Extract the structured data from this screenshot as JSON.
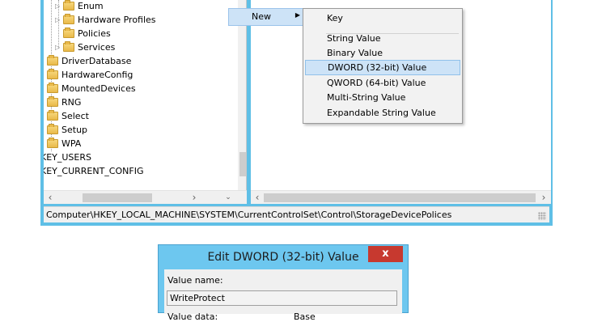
{
  "tree": {
    "items": [
      {
        "label": "Enum"
      },
      {
        "label": "Hardware Profiles"
      },
      {
        "label": "Policies"
      },
      {
        "label": "Services"
      },
      {
        "label": "DriverDatabase"
      },
      {
        "label": "HardwareConfig"
      },
      {
        "label": "MountedDevices"
      },
      {
        "label": "RNG"
      },
      {
        "label": "Select"
      },
      {
        "label": "Setup"
      },
      {
        "label": "WPA"
      },
      {
        "label": "KEY_USERS"
      },
      {
        "label": "KEY_CURRENT_CONFIG"
      }
    ]
  },
  "status_bar": {
    "path": "Computer\\HKEY_LOCAL_MACHINE\\SYSTEM\\CurrentControlSet\\Control\\StorageDevicePolices"
  },
  "context_menu": {
    "new_label": "New",
    "submenu": [
      {
        "label": "Key"
      },
      {
        "label": "String Value"
      },
      {
        "label": "Binary Value"
      },
      {
        "label": "DWORD (32-bit) Value"
      },
      {
        "label": "QWORD (64-bit) Value"
      },
      {
        "label": "Multi-String Value"
      },
      {
        "label": "Expandable String Value"
      }
    ]
  },
  "dialog": {
    "title": "Edit DWORD (32-bit) Value",
    "close_glyph": "x",
    "value_name_label": "Value name:",
    "value_name": "WriteProtect",
    "value_data_label": "Value data:",
    "base_label": "Base"
  },
  "colors": {
    "window_frame": "#5fbfe6",
    "highlight": "#cde3f7",
    "close_button": "#c7392f"
  }
}
